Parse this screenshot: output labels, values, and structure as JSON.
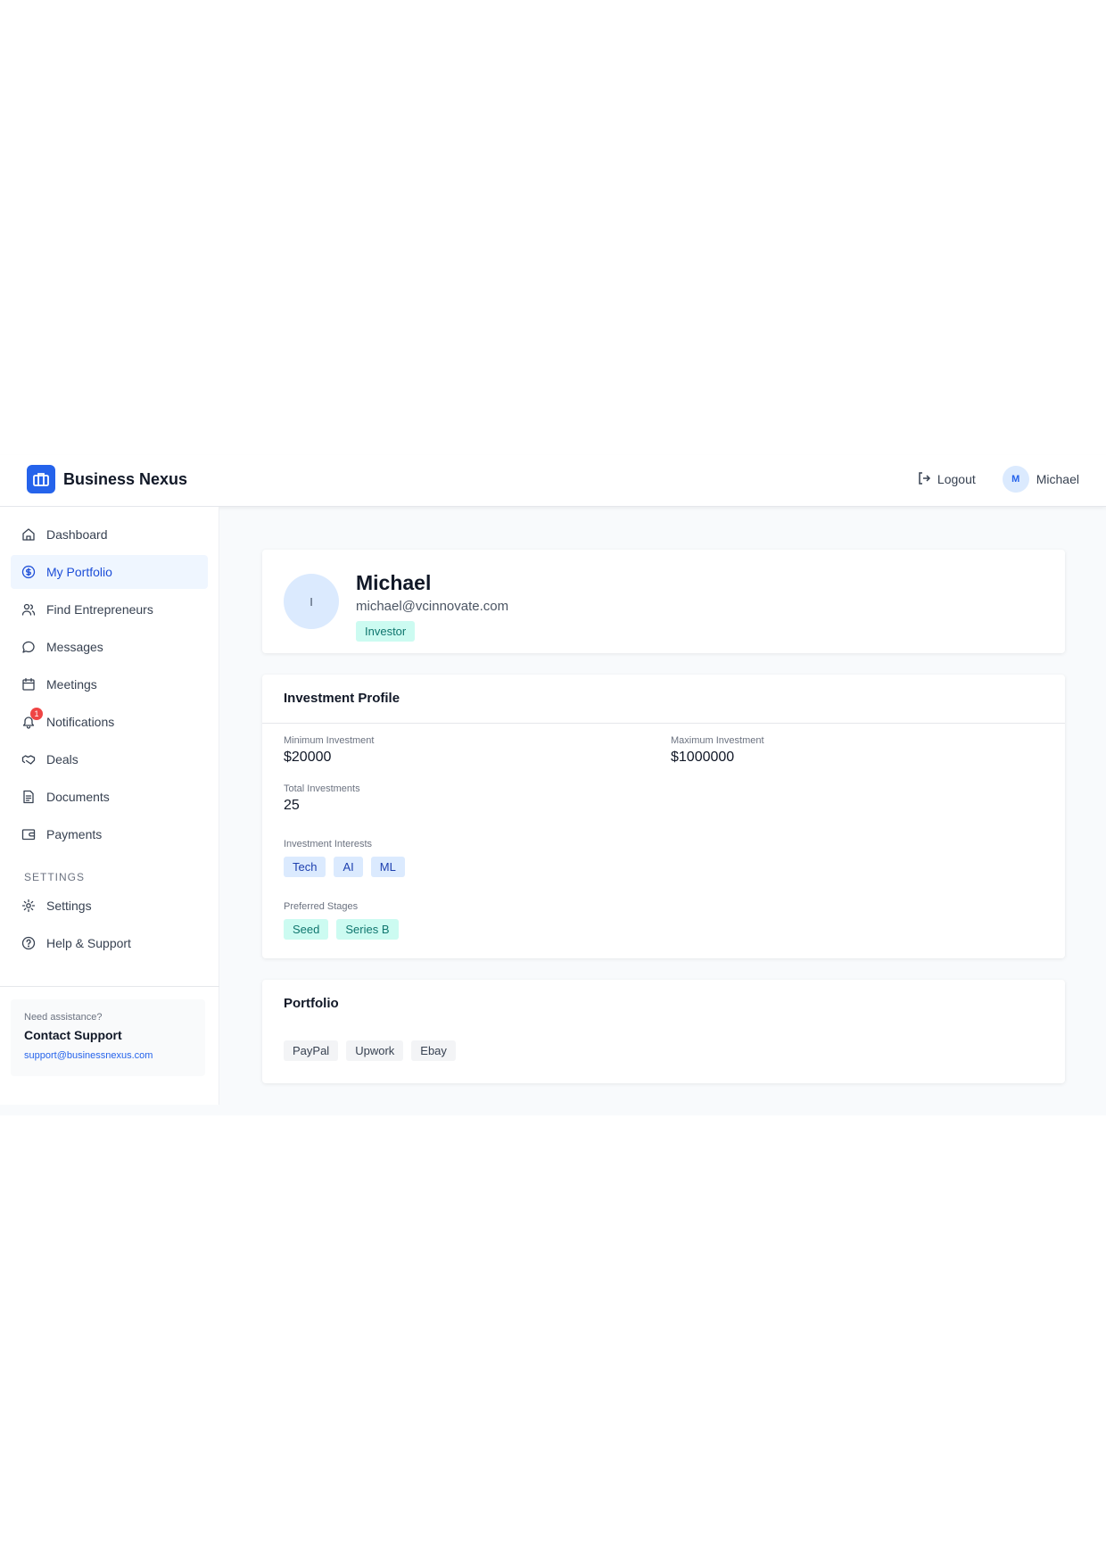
{
  "header": {
    "brand_name": "Business Nexus",
    "logout_label": "Logout",
    "user_initial": "M",
    "user_name": "Michael"
  },
  "sidebar": {
    "items": [
      {
        "label": "Dashboard",
        "icon": "home-icon"
      },
      {
        "label": "My Portfolio",
        "icon": "dollar-circle-icon",
        "active": true
      },
      {
        "label": "Find Entrepreneurs",
        "icon": "users-icon"
      },
      {
        "label": "Messages",
        "icon": "message-icon"
      },
      {
        "label": "Meetings",
        "icon": "calendar-icon"
      },
      {
        "label": "Notifications",
        "icon": "bell-icon",
        "badge": "1"
      },
      {
        "label": "Deals",
        "icon": "handshake-icon"
      },
      {
        "label": "Documents",
        "icon": "document-icon"
      },
      {
        "label": "Payments",
        "icon": "wallet-icon"
      }
    ],
    "settings_heading": "SETTINGS",
    "settings_items": [
      {
        "label": "Settings",
        "icon": "gear-icon"
      },
      {
        "label": "Help & Support",
        "icon": "help-circle-icon"
      }
    ],
    "support": {
      "question": "Need assistance?",
      "title": "Contact Support",
      "email": "support@businessnexus.com"
    }
  },
  "profile": {
    "avatar_initial": "I",
    "name": "Michael",
    "email": "michael@vcinnovate.com",
    "role": "Investor"
  },
  "investment_profile": {
    "title": "Investment Profile",
    "min_label": "Minimum Investment",
    "min_value": "$20000",
    "max_label": "Maximum Investment",
    "max_value": "$1000000",
    "total_label": "Total Investments",
    "total_value": "25",
    "interests_label": "Investment Interests",
    "interests": [
      "Tech",
      "AI",
      "ML"
    ],
    "stages_label": "Preferred Stages",
    "stages": [
      "Seed",
      "Series B"
    ]
  },
  "portfolio": {
    "title": "Portfolio",
    "companies": [
      "PayPal",
      "Upwork",
      "Ebay"
    ]
  },
  "colors": {
    "accent": "#2563eb",
    "active_bg": "#eff6ff",
    "teal_pill_bg": "#ccfbf1",
    "blue_pill_bg": "#dbeafe",
    "badge": "#ef4444"
  }
}
